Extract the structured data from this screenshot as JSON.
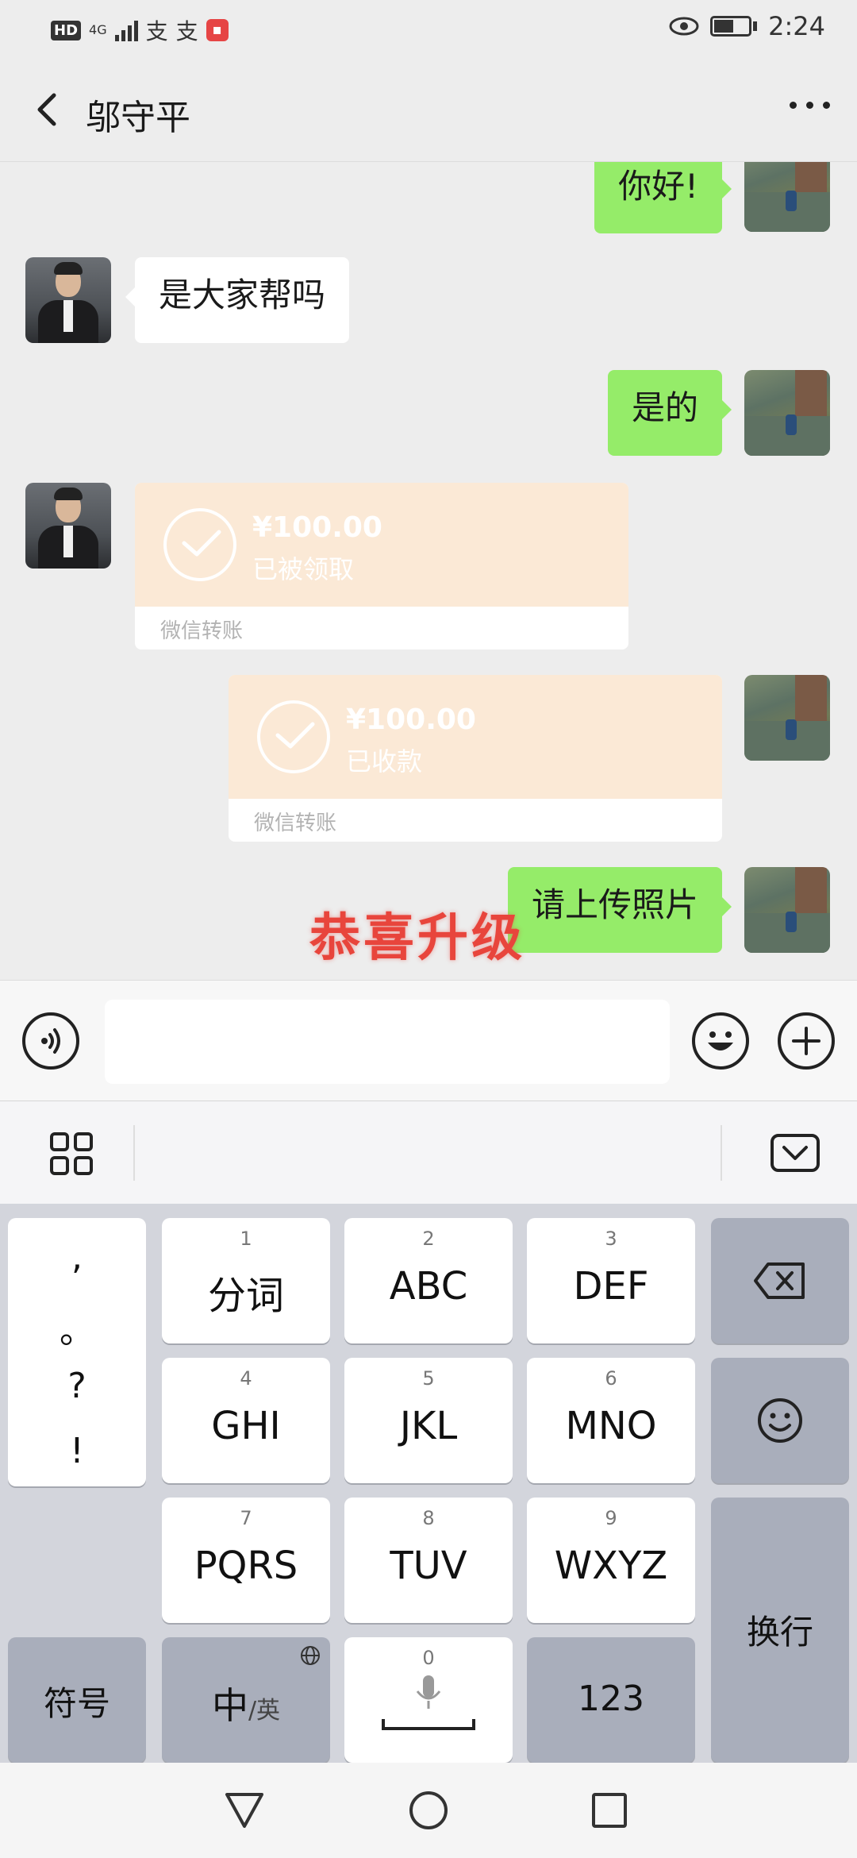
{
  "status_bar": {
    "hd": "HD",
    "network": "4G",
    "app_icons": [
      "支",
      "支"
    ],
    "time": "2:24"
  },
  "header": {
    "title": "邬守平"
  },
  "messages": [
    {
      "side": "right",
      "type": "text",
      "text": "你好!"
    },
    {
      "side": "left",
      "type": "text",
      "text": "是大家帮吗"
    },
    {
      "side": "right",
      "type": "text",
      "text": "是的"
    },
    {
      "side": "left",
      "type": "transfer",
      "amount": "¥100.00",
      "status": "已被领取",
      "footer": "微信转账"
    },
    {
      "side": "right",
      "type": "transfer",
      "amount": "¥100.00",
      "status": "已收款",
      "footer": "微信转账"
    },
    {
      "side": "right",
      "type": "text",
      "text": "请上传照片"
    }
  ],
  "overlay": {
    "congrats_text": "恭喜升级",
    "color": "#e8453c"
  },
  "keyboard": {
    "punct": [
      ",",
      "。",
      "?",
      "!"
    ],
    "keys": [
      {
        "num": "1",
        "label": "分词"
      },
      {
        "num": "2",
        "label": "ABC"
      },
      {
        "num": "3",
        "label": "DEF"
      },
      {
        "num": "4",
        "label": "GHI"
      },
      {
        "num": "5",
        "label": "JKL"
      },
      {
        "num": "6",
        "label": "MNO"
      },
      {
        "num": "7",
        "label": "PQRS"
      },
      {
        "num": "8",
        "label": "TUV"
      },
      {
        "num": "9",
        "label": "WXYZ"
      }
    ],
    "symbols": "符号",
    "lang_main": "中",
    "lang_alt": "/英",
    "space_num": "0",
    "num_key": "123",
    "enter": "换行"
  },
  "colors": {
    "bg": "#ededed",
    "bubble_green": "#95ec69",
    "transfer_bg": "#fbe9d6",
    "keyboard_bg": "#d3d5dc"
  }
}
